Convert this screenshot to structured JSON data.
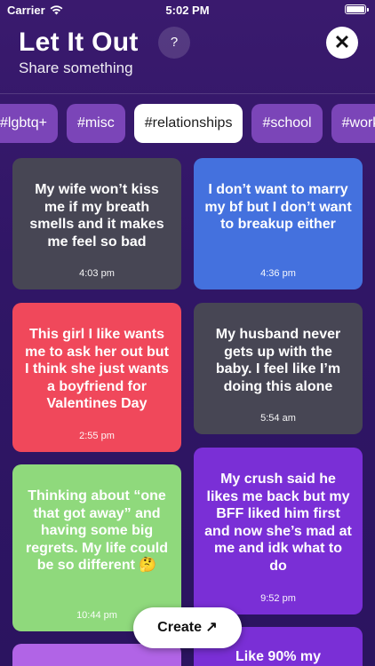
{
  "status": {
    "carrier": "Carrier",
    "time": "5:02 PM"
  },
  "header": {
    "title": "Let It Out",
    "subtitle": "Share something",
    "help_label": "?",
    "close_label": "✕"
  },
  "tags": [
    {
      "label": "#lgbtq+",
      "active": false
    },
    {
      "label": "#misc",
      "active": false
    },
    {
      "label": "#relationships",
      "active": true
    },
    {
      "label": "#school",
      "active": false
    },
    {
      "label": "#work",
      "active": false
    }
  ],
  "cards": [
    {
      "text": "My wife won’t kiss me if my breath smells and it makes me feel so bad",
      "time": "4:03 pm",
      "color": "#474654"
    },
    {
      "text": "I don’t want to marry my bf but I don’t want to breakup either",
      "time": "4:36 pm",
      "color": "#4471de"
    },
    {
      "text": "This girl I like wants me to ask her out but I think she just wants a boyfriend for Valentines Day",
      "time": "2:55 pm",
      "color": "#f0485b"
    },
    {
      "text": "My husband never gets up with the baby. I feel like I’m doing this alone",
      "time": "5:54 am",
      "color": "#474654"
    },
    {
      "text": "Thinking about “one that got away” and having some big regrets. My life could be so different 🤔",
      "time": "10:44 pm",
      "color": "#8fd97c"
    },
    {
      "text": "My crush said he likes me back but my BFF liked him first and now she’s mad at me and idk what to do",
      "time": "9:52 pm",
      "color": "#7a2fd6"
    },
    {
      "text": "",
      "time": "",
      "color": "#b164e6"
    },
    {
      "text": "Like 90% my",
      "time": "",
      "color": "#7a2fd6"
    }
  ],
  "create_label": "Create ↗"
}
